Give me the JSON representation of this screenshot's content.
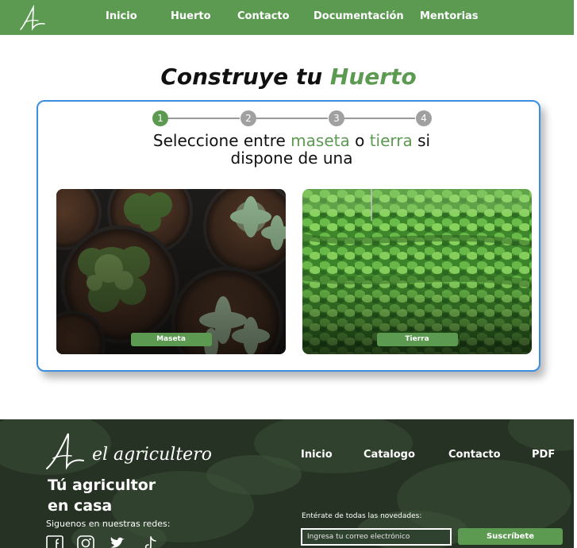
{
  "nav": {
    "logo_icon": "leaf-script-logo-icon",
    "items": [
      "Inicio",
      "Huerto",
      "Contacto",
      "Documentación",
      "Mentorias"
    ]
  },
  "main": {
    "title_part1": "Construye tu",
    "title_part2": "Huerto",
    "steps": [
      "1",
      "2",
      "3",
      "4"
    ],
    "active_step": 1,
    "prompt": {
      "p1": "Seleccione entre",
      "option1": "maseta",
      "p2": "o",
      "option2": "tierra",
      "p3": "si",
      "p4": "dispone de una"
    },
    "options": [
      {
        "label": "Maseta",
        "image": "potted-succulents-photo"
      },
      {
        "label": "Tierra",
        "image": "lettuce-field-photo"
      }
    ]
  },
  "footer": {
    "brand": "el agricultero",
    "tagline_line1": "Tú agricultor",
    "tagline_line2": "en casa",
    "social_label": "Siguenos en nuestras redes:",
    "social_icons": [
      "facebook-icon",
      "instagram-icon",
      "twitter-icon",
      "tiktok-icon"
    ],
    "links": [
      "Inicio",
      "Catalogo",
      "Contacto",
      "PDF"
    ],
    "newsletter_label": "Entérate de todas las novedades:",
    "email_placeholder": "Ingresa tu correo electrónico",
    "subscribe_label": "Suscríbete"
  },
  "colors": {
    "brand_green": "#5c9a52",
    "card_border": "#3e8ee0",
    "step_inactive": "#a0a0a0",
    "footer_bg": "#2e3d2c"
  }
}
